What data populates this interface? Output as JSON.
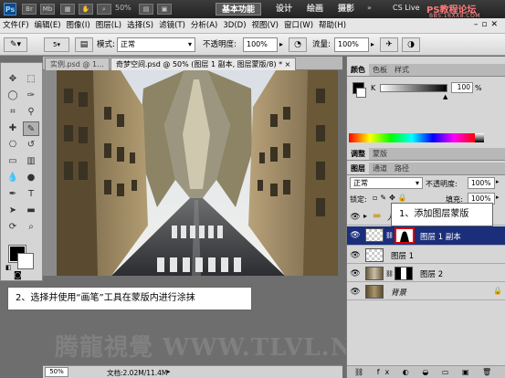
{
  "appbar": {
    "logo": "Ps",
    "icons": [
      "Br",
      "Mb"
    ],
    "zoom": "50%",
    "workspaces": [
      "基本功能",
      "设计",
      "绘画",
      "摄影"
    ],
    "active_workspace": "基本功能",
    "cs_live": "CS Live"
  },
  "watermark_top": {
    "title": "PS教程论坛",
    "url": "BBS.16XX8.COM"
  },
  "menu": [
    "文件(F)",
    "编辑(E)",
    "图像(I)",
    "图层(L)",
    "选择(S)",
    "滤镜(T)",
    "分析(A)",
    "3D(D)",
    "视图(V)",
    "窗口(W)",
    "帮助(H)"
  ],
  "options": {
    "brush_size": "5",
    "mode_label": "模式:",
    "mode_value": "正常",
    "opacity_label": "不透明度:",
    "opacity_value": "100%",
    "flow_label": "流量:",
    "flow_value": "100%"
  },
  "document": {
    "tabs": [
      "实例.psd @ 1...",
      "奇梦空间.psd @ 50% (图层 1 副本, 图层蒙版/8) * ×"
    ],
    "zoom": "50%",
    "doc_info": "文档:2.02M/11.4M"
  },
  "callouts": {
    "step1": "1、添加图层蒙版",
    "step2": "2、选择并使用“画笔”工具在蒙版内进行涂抹"
  },
  "color_panel": {
    "tabs": [
      "颜色",
      "色板",
      "样式"
    ],
    "slider_value": "100",
    "slider_pct": "%",
    "value_fraction": 1.0
  },
  "adjust_panel": {
    "tabs": [
      "调整",
      "蒙版"
    ]
  },
  "layers_panel": {
    "tabs": [
      "图层",
      "通道",
      "路径"
    ],
    "blend_mode": "正常",
    "opacity_label": "不透明度:",
    "opacity_value": "100%",
    "lock_label": "锁定:",
    "fill_label": "填充:",
    "fill_value": "100%",
    "layers": [
      {
        "name": "人物",
        "type": "group"
      },
      {
        "name": "图层 1 副本",
        "type": "mask",
        "selected": true
      },
      {
        "name": "图层 1",
        "type": "plain"
      },
      {
        "name": "图层 2",
        "type": "mask2"
      },
      {
        "name": "背景",
        "type": "bg"
      }
    ]
  },
  "watermark_bottom": "腾龍視覺 WWW.TLVL.NET",
  "colors": {
    "selection": "#1a2e7a",
    "callout_border": "#cc0000",
    "accent_blue": "#0d4a86"
  }
}
